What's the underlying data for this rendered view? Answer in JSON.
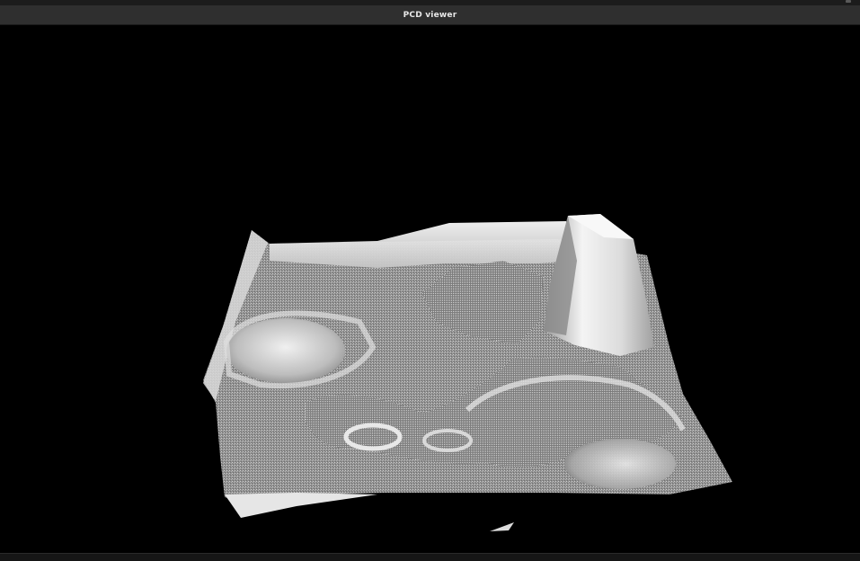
{
  "window": {
    "title": "PCD viewer"
  },
  "viewport": {
    "content": "point-cloud-render",
    "background": "#000000",
    "point_color": "#c8c8c8"
  }
}
